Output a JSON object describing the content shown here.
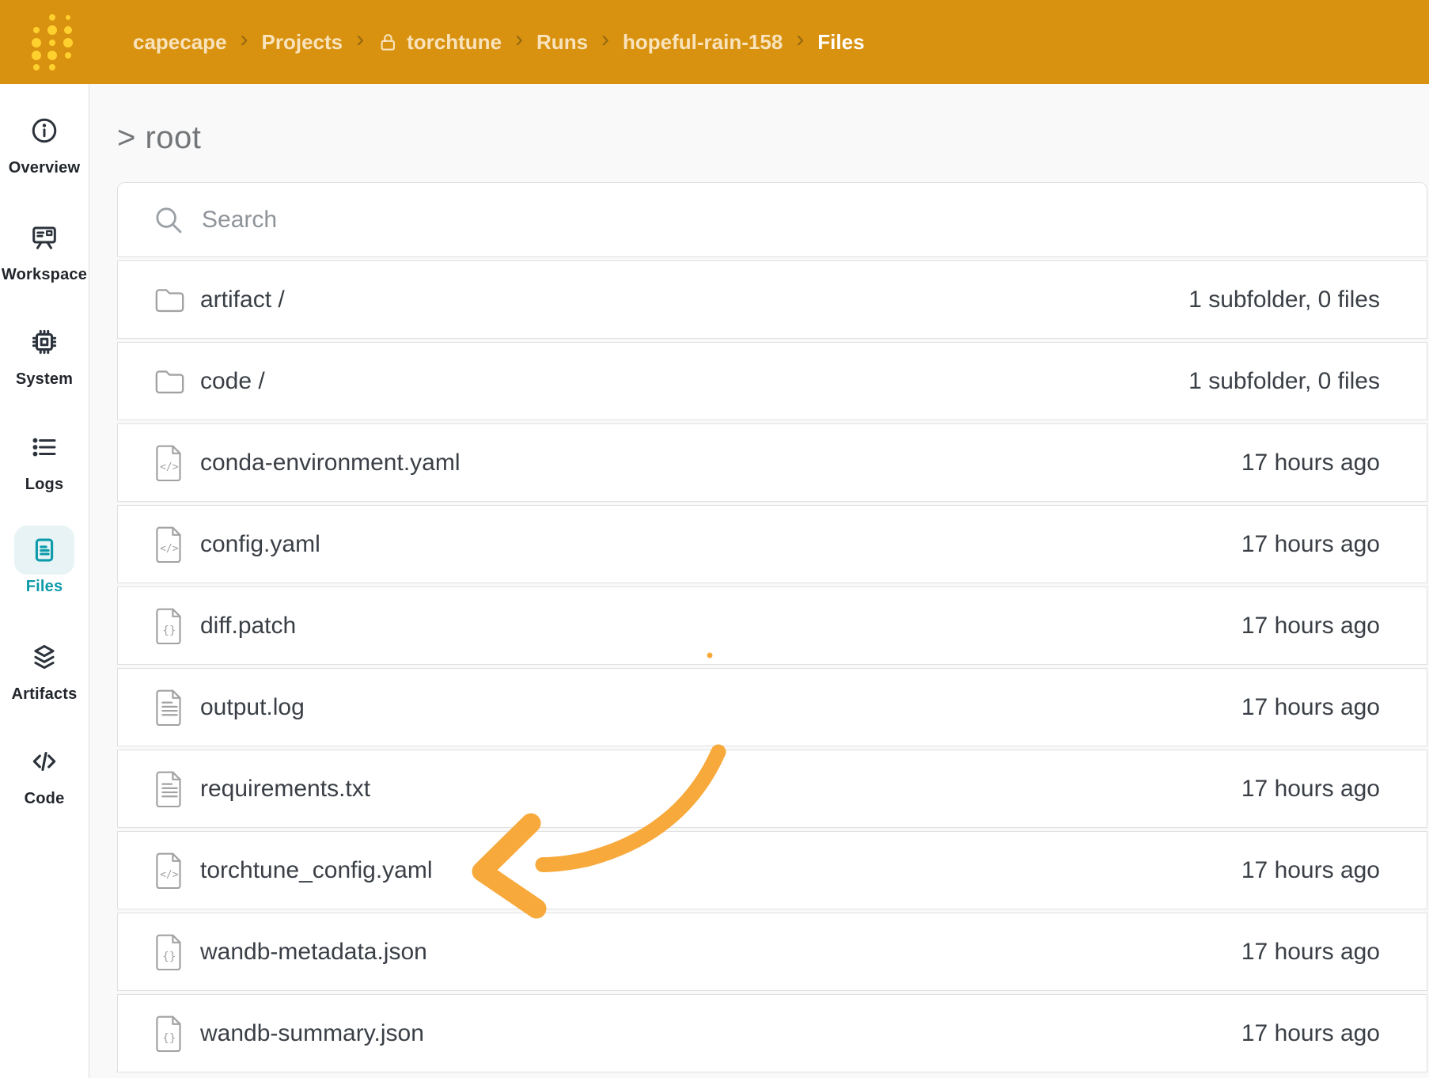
{
  "header": {
    "logo": "wandb-logo",
    "breadcrumb": [
      {
        "label": "capecape"
      },
      {
        "label": "Projects"
      },
      {
        "label": "torchtune",
        "lock": true
      },
      {
        "label": "Runs"
      },
      {
        "label": "hopeful-rain-158"
      },
      {
        "label": "Files",
        "current": true
      }
    ]
  },
  "sidebar": {
    "items": [
      {
        "id": "overview",
        "label": "Overview",
        "icon": "info-circle-icon"
      },
      {
        "id": "workspace",
        "label": "Workspace",
        "icon": "workspace-board-icon"
      },
      {
        "id": "system",
        "label": "System",
        "icon": "cpu-chip-icon"
      },
      {
        "id": "logs",
        "label": "Logs",
        "icon": "list-icon"
      },
      {
        "id": "files",
        "label": "Files",
        "icon": "document-icon",
        "active": true
      },
      {
        "id": "artifacts",
        "label": "Artifacts",
        "icon": "layers-icon"
      },
      {
        "id": "code",
        "label": "Code",
        "icon": "code-icon"
      }
    ]
  },
  "main": {
    "path_heading": "> root",
    "search_placeholder": "Search",
    "files": [
      {
        "name": "artifact /",
        "icon": "folder-icon",
        "meta": "1 subfolder, 0 files"
      },
      {
        "name": "code /",
        "icon": "folder-icon",
        "meta": "1 subfolder, 0 files"
      },
      {
        "name": "conda-environment.yaml",
        "icon": "code-file-icon",
        "meta": "17 hours ago"
      },
      {
        "name": "config.yaml",
        "icon": "code-file-icon",
        "meta": "17 hours ago"
      },
      {
        "name": "diff.patch",
        "icon": "braces-file-icon",
        "meta": "17 hours ago"
      },
      {
        "name": "output.log",
        "icon": "text-file-icon",
        "meta": "17 hours ago"
      },
      {
        "name": "requirements.txt",
        "icon": "text-file-icon",
        "meta": "17 hours ago"
      },
      {
        "name": "torchtune_config.yaml",
        "icon": "code-file-icon",
        "meta": "17 hours ago"
      },
      {
        "name": "wandb-metadata.json",
        "icon": "braces-file-icon",
        "meta": "17 hours ago"
      },
      {
        "name": "wandb-summary.json",
        "icon": "braces-file-icon",
        "meta": "17 hours ago"
      }
    ]
  },
  "colors": {
    "header_bg": "#d9920f",
    "logo_dot": "#ffd12e",
    "accent_teal": "#0d9bab",
    "annotation_arrow": "#f8a93b"
  }
}
